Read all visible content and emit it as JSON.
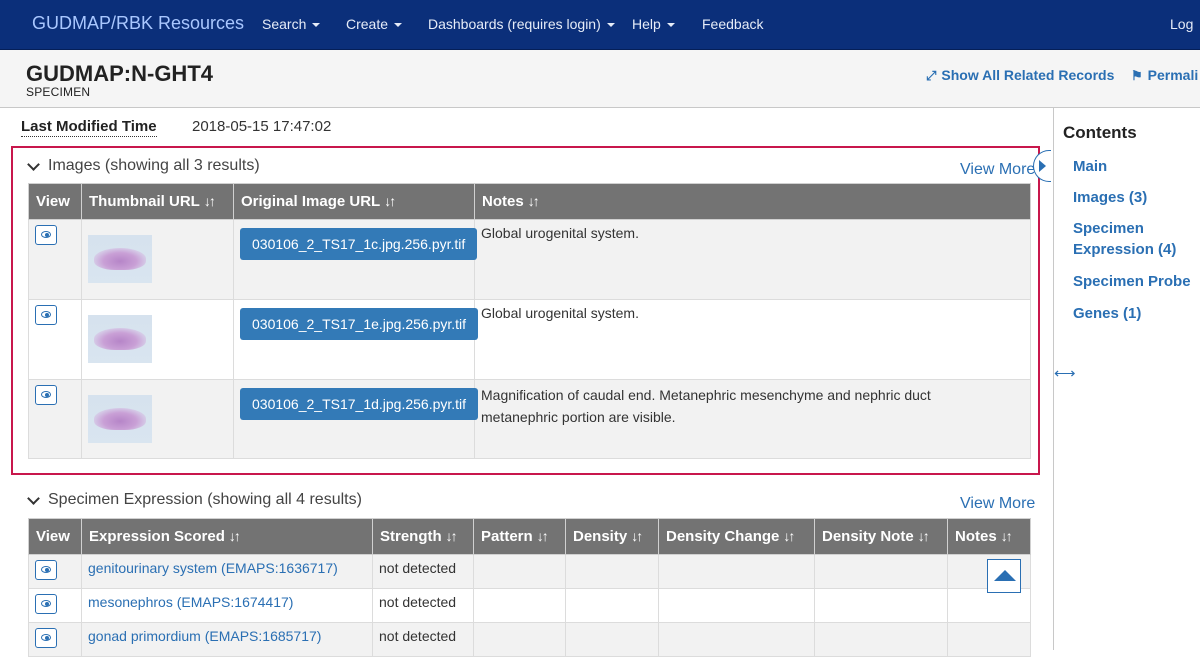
{
  "navbar": {
    "brand": "GUDMAP/RBK Resources",
    "items": [
      {
        "label": "Search",
        "dropdown": true
      },
      {
        "label": "Create",
        "dropdown": true
      },
      {
        "label": "Dashboards (requires login)",
        "dropdown": true
      },
      {
        "label": "Help",
        "dropdown": true
      },
      {
        "label": "Feedback",
        "dropdown": false
      }
    ],
    "login": "Log"
  },
  "record": {
    "title": "GUDMAP:N-GHT4",
    "subtitle": "SPECIMEN",
    "show_all_related": "Show All Related Records",
    "permalink": "Permali"
  },
  "last_modified": {
    "label": "Last Modified Time",
    "value": "2018-05-15 17:47:02"
  },
  "images_section": {
    "title": "Images (showing all 3 results)",
    "view_more": "View More",
    "columns": [
      "View",
      "Thumbnail URL",
      "Original Image URL",
      "Notes"
    ],
    "sort_glyph": "↓↑",
    "rows": [
      {
        "original_image": "030106_2_TS17_1c.jpg.256.pyr.tif",
        "notes": "Global urogenital system."
      },
      {
        "original_image": "030106_2_TS17_1e.jpg.256.pyr.tif",
        "notes": "Global urogenital system."
      },
      {
        "original_image": "030106_2_TS17_1d.jpg.256.pyr.tif",
        "notes": "Magnification of caudal end. Metanephric mesenchyme and nephric duct metanephric portion are visible."
      }
    ]
  },
  "expression_section": {
    "title": "Specimen Expression (showing all 4 results)",
    "view_more": "View More",
    "columns": [
      "View",
      "Expression Scored",
      "Strength",
      "Pattern",
      "Density",
      "Density Change",
      "Density Note",
      "Notes"
    ],
    "rows": [
      {
        "expression": "genitourinary system (EMAPS:1636717)",
        "strength": "not detected"
      },
      {
        "expression": "mesonephros (EMAPS:1674417)",
        "strength": "not detected"
      },
      {
        "expression": "gonad primordium (EMAPS:1685717)",
        "strength": "not detected"
      }
    ]
  },
  "sidebar": {
    "title": "Contents",
    "items": [
      "Main",
      "Images (3)",
      "Specimen Expression (4)",
      "Specimen Probe",
      "Genes (1)"
    ]
  },
  "colors": {
    "navbar_bg": "#0b2f7a",
    "accent": "#2a6fb3",
    "highlight_border": "#c8174c",
    "table_header": "#737373",
    "button_blue": "#337ab7"
  }
}
